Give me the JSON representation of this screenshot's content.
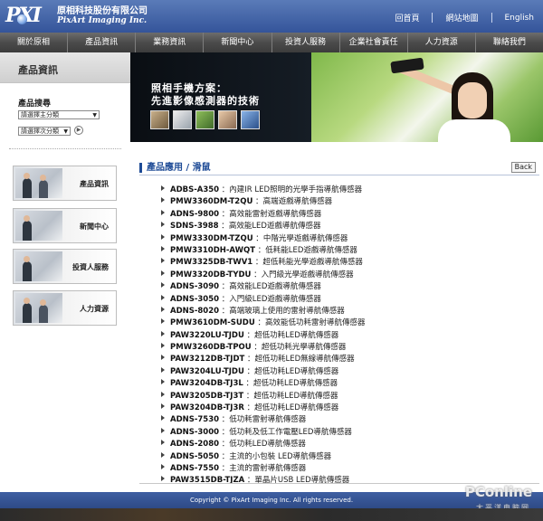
{
  "header": {
    "logo_text": "PXI",
    "company_cn": "原相科技股份有限公司",
    "company_en": "PixArt Imaging Inc.",
    "links": [
      "回首頁",
      "網站地圖",
      "English"
    ]
  },
  "nav": [
    "關於原相",
    "產品資訊",
    "業務資訊",
    "新聞中心",
    "投資人服務",
    "企業社會責任",
    "人力資源",
    "聯絡我們"
  ],
  "sidebar": {
    "title": "產品資訊",
    "search_label": "產品搜尋",
    "select_main": "請選擇主分類",
    "select_sub": "請選擇次分類",
    "cards": [
      "產品資訊",
      "新聞中心",
      "投資人服務",
      "人力資源"
    ]
  },
  "banner": {
    "line1": "照相手機方案：",
    "line2": "先進影像感測器的技術"
  },
  "main": {
    "breadcrumb": "產品應用 / 滑鼠",
    "back_label": "Back",
    "products": [
      {
        "model": "ADBS-A350",
        "desc": "內建IR LED照明的光學手指導航傳感器"
      },
      {
        "model": "PMW3360DM-T2QU",
        "desc": "高端遊戲導航傳感器"
      },
      {
        "model": "ADNS-9800",
        "desc": "高效能雷射遊戲導航傳感器"
      },
      {
        "model": "SDNS-3988",
        "desc": "高效能LED遊戲導航傳感器"
      },
      {
        "model": "PMW3330DM-TZQU",
        "desc": "中階光學遊戲導航傳感器"
      },
      {
        "model": "PMW3310DH-AWQT",
        "desc": "低耗能LED遊戲導航傳感器"
      },
      {
        "model": "PMW3325DB-TWV1",
        "desc": "超低耗能光學遊戲導航傳感器"
      },
      {
        "model": "PMW3320DB-TYDU",
        "desc": "入門級光學遊戲導航傳感器"
      },
      {
        "model": "ADNS-3090",
        "desc": "高效能LED遊戲導航傳感器"
      },
      {
        "model": "ADNS-3050",
        "desc": "入門級LED遊戲導航傳感器"
      },
      {
        "model": "ADNS-8020",
        "desc": "高端玻璃上使用的雷射導航傳感器"
      },
      {
        "model": "PMW3610DM-SUDU",
        "desc": "高效能低功耗雷射導航傳感器"
      },
      {
        "model": "PAW3220LU-TJDU",
        "desc": "超低功耗LED導航傳感器"
      },
      {
        "model": "PMW3260DB-TPOU",
        "desc": "超低功耗光學導航傳感器"
      },
      {
        "model": "PAW3212DB-TJDT",
        "desc": "超低功耗LED無線導航傳感器"
      },
      {
        "model": "PAW3204LU-TJDU",
        "desc": "超低功耗LED導航傳感器"
      },
      {
        "model": "PAW3204DB-TJ3L",
        "desc": "超低功耗LED導航傳感器"
      },
      {
        "model": "PAW3205DB-TJ3T",
        "desc": "超低功耗LED導航傳感器"
      },
      {
        "model": "PAW3204DB-TJ3R",
        "desc": "超低功耗LED導航傳感器"
      },
      {
        "model": "ADNS-7530",
        "desc": "低功耗雷射導航傳感器"
      },
      {
        "model": "ADNS-3000",
        "desc": "低功耗及低工作電壓LED導航傳感器"
      },
      {
        "model": "ADNS-2080",
        "desc": "低功耗LED導航傳感器"
      },
      {
        "model": "ADNS-5050",
        "desc": "主流的小包裝 LED導航傳感器"
      },
      {
        "model": "ADNS-7550",
        "desc": "主流的雷射導航傳感器"
      },
      {
        "model": "PAW3515DB-TJZA",
        "desc": "單晶片USB LED導航傳感器"
      }
    ]
  },
  "footer": {
    "copyright": "Copyright © PixArt Imaging Inc. All rights reserved."
  },
  "watermark": {
    "brand": "PConline",
    "sub": "太平洋电脑网"
  }
}
